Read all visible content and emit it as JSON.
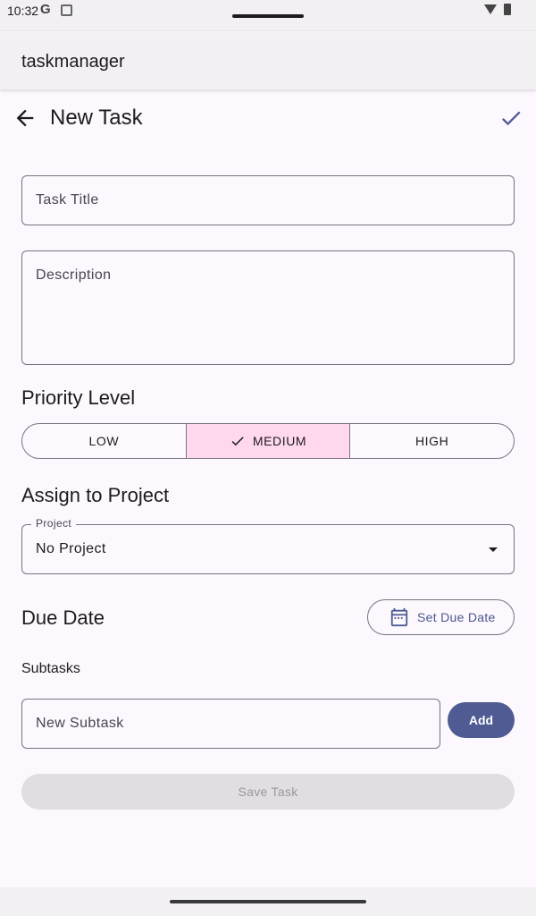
{
  "status_bar": {
    "time": "10:32",
    "g_label": "G"
  },
  "app_bar": {
    "title": "taskmanager"
  },
  "header": {
    "title": "New Task"
  },
  "form": {
    "title_placeholder": "Task Title",
    "description_placeholder": "Description",
    "priority_heading": "Priority Level",
    "priority_options": [
      {
        "label": "LOW",
        "selected": false
      },
      {
        "label": "MEDIUM",
        "selected": true
      },
      {
        "label": "HIGH",
        "selected": false
      }
    ],
    "project_heading": "Assign to Project",
    "project_label": "Project",
    "project_value": "No Project",
    "due_heading": "Due Date",
    "due_button_label": "Set Due Date",
    "subtasks_label": "Subtasks",
    "subtask_placeholder": "New Subtask",
    "add_button_label": "Add",
    "save_button_label": "Save Task"
  },
  "icons": {
    "back": "arrow-back-icon",
    "confirm": "check-icon",
    "selected_check": "check-icon",
    "dropdown": "arrow-drop-down-icon",
    "calendar": "calendar-icon"
  },
  "colors": {
    "accent": "#4f5b92",
    "selected_segment": "#ffd8ee",
    "disabled_button": "#e1dee3"
  }
}
